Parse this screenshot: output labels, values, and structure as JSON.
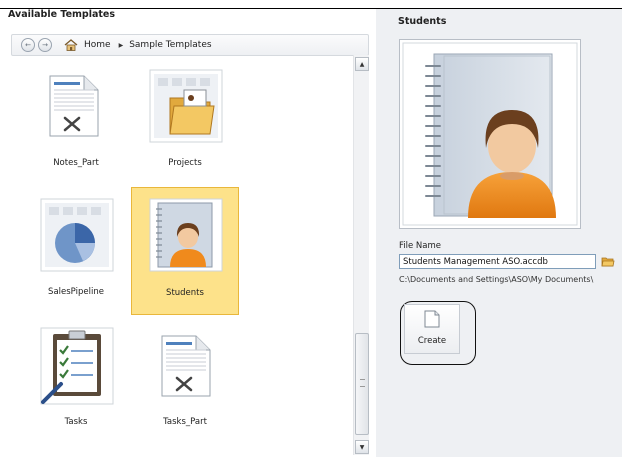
{
  "left_pane": {
    "title": "Available Templates",
    "breadcrumb": {
      "back_glyph": "←",
      "forward_glyph": "→",
      "home_label": "Home",
      "separator": "▶",
      "current": "Sample Templates"
    },
    "templates": [
      {
        "label": "Notes_Part",
        "icon": "table-document-icon",
        "selected": false
      },
      {
        "label": "Projects",
        "icon": "project-folder-icon",
        "selected": false
      },
      {
        "label": "SalesPipeline",
        "icon": "pie-chart-icon",
        "selected": false
      },
      {
        "label": "Students",
        "icon": "student-notebook-icon",
        "selected": true
      },
      {
        "label": "Tasks",
        "icon": "task-clipboard-icon",
        "selected": false
      },
      {
        "label": "Tasks_Part",
        "icon": "table-document-icon",
        "selected": false
      }
    ],
    "scrollbar": {
      "up": "▲",
      "down": "▼"
    }
  },
  "right_pane": {
    "title": "Students",
    "file_name_label": "File Name",
    "file_name_value": "Students Management ASO.accdb",
    "file_path": "C:\\Documents and Settings\\ASO\\My Documents\\",
    "create_label": "Create"
  },
  "colors": {
    "selected_fill": "#fde28a",
    "selected_border": "#e9b73b",
    "right_pane_bg": "#eef0f3",
    "avatar_shirt": "#f08a1c",
    "avatar_hair": "#6b3f1e"
  }
}
